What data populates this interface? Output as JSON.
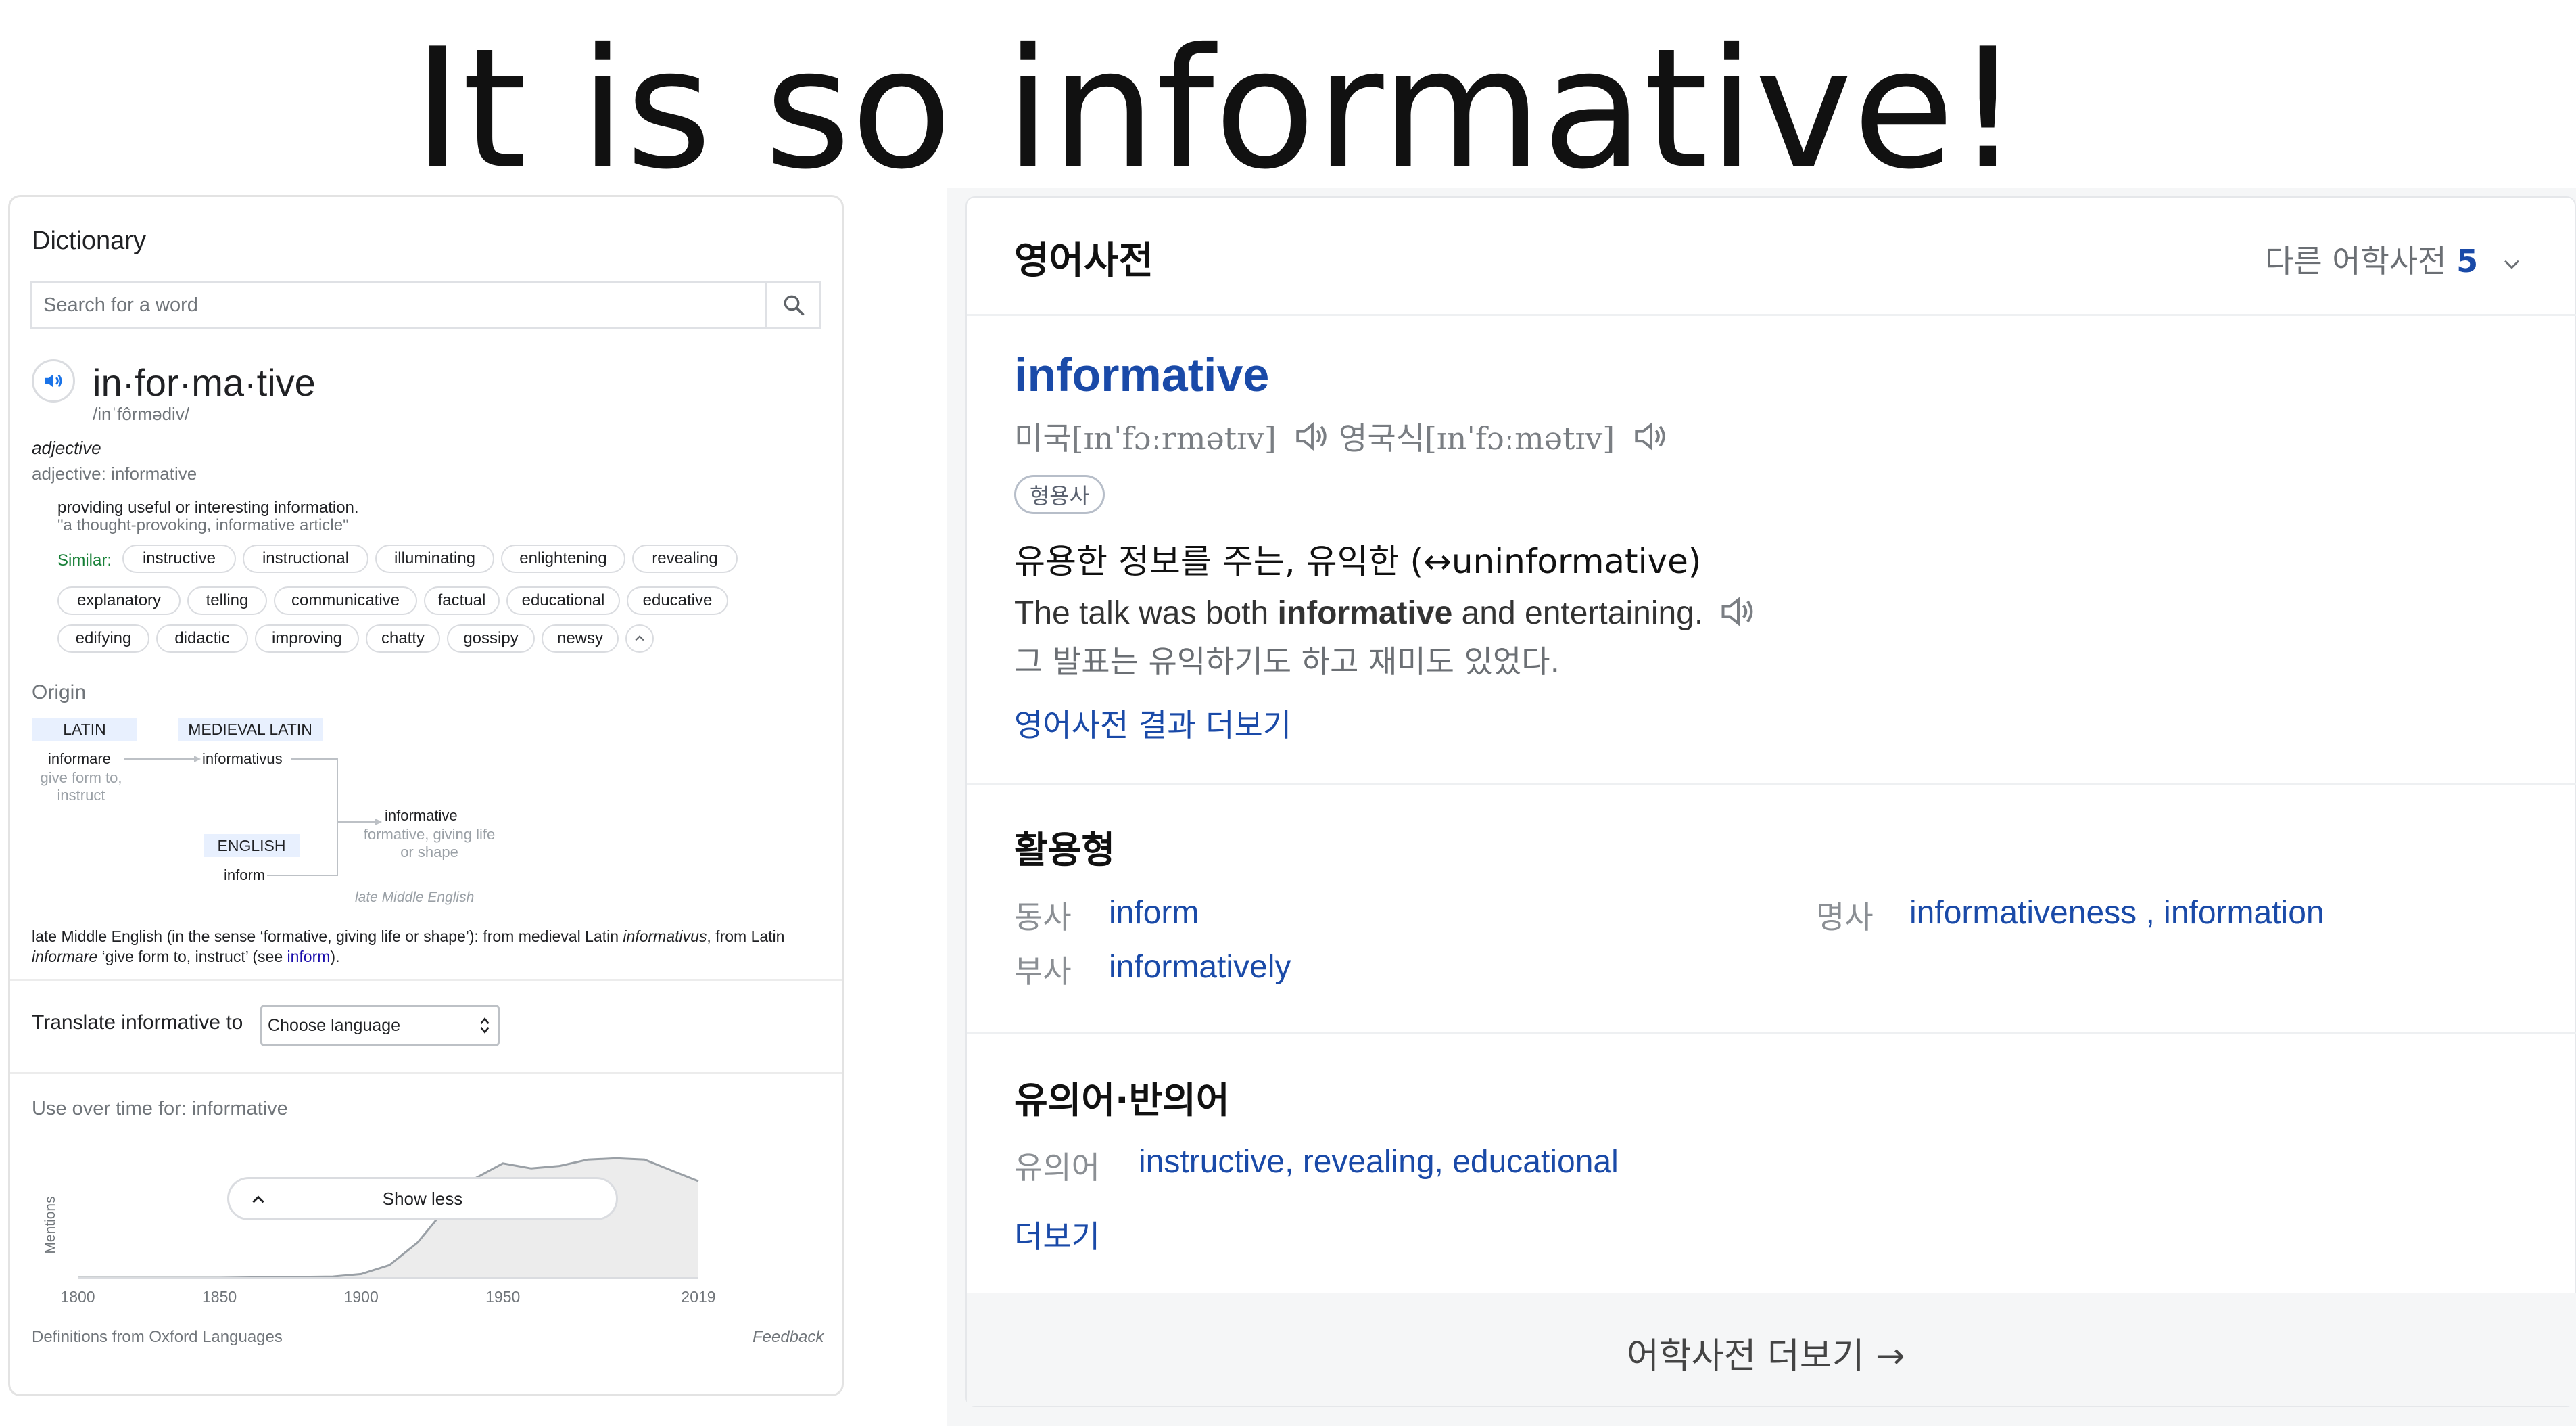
{
  "slide": {
    "title": "It is so informative!"
  },
  "google_dictionary": {
    "heading": "Dictionary",
    "search_placeholder": "Search for a word",
    "headword": "in·for·ma·tive",
    "phonetic": "/inˈfôrmədiv/",
    "part_of_speech": "adjective",
    "pos_line": "adjective: informative",
    "definition": "providing useful or interesting information.",
    "example": "\"a thought-provoking, informative article\"",
    "similar_label": "Similar:",
    "similar_words": [
      "instructive",
      "instructional",
      "illuminating",
      "enlightening",
      "revealing",
      "explanatory",
      "telling",
      "communicative",
      "factual",
      "educational",
      "educative",
      "edifying",
      "didactic",
      "improving",
      "chatty",
      "gossipy",
      "newsy"
    ],
    "origin_heading": "Origin",
    "etymology": {
      "latin_tag": "LATIN",
      "medieval_latin_tag": "MEDIEVAL LATIN",
      "english_tag": "ENGLISH",
      "informare": "informare",
      "informare_gloss": "give form to, instruct",
      "informativus": "informativus",
      "inform": "inform",
      "informative": "informative",
      "informative_gloss": "formative, giving life or shape",
      "era": "late Middle English"
    },
    "etymology_text": {
      "p1": "late Middle English (in the sense ‘formative, giving life or shape’): from medieval Latin ",
      "w1": "informativus",
      "p2": ", from Latin ",
      "w2": "informare",
      "p3": " ‘give form to, instruct’ (see ",
      "link": "inform",
      "p4": ")."
    },
    "translate_label": "Translate informative to",
    "language_select": "Choose language",
    "usage_label": "Use over time for: informative",
    "oxford_credit": "Definitions from Oxford Languages",
    "feedback": "Feedback",
    "show_less": "Show less"
  },
  "chart_data": {
    "type": "area",
    "title": "Use over time for: informative",
    "ylabel": "Mentions",
    "x_ticks": [
      "1800",
      "1850",
      "1900",
      "1950",
      "2019"
    ],
    "x": [
      1800,
      1850,
      1890,
      1900,
      1910,
      1920,
      1930,
      1940,
      1950,
      1960,
      1970,
      1980,
      1990,
      2000,
      2010,
      2019
    ],
    "y": [
      0.0,
      0.0,
      0.01,
      0.03,
      0.1,
      0.28,
      0.55,
      0.78,
      0.9,
      0.86,
      0.88,
      0.93,
      0.94,
      0.93,
      0.84,
      0.76
    ],
    "ylim": [
      0,
      1
    ],
    "xlim": [
      1800,
      2019
    ]
  },
  "naver_dictionary": {
    "title": "영어사전",
    "other_dicts_label": "다른 어학사전",
    "other_dicts_count": "5",
    "headword": "informative",
    "pron_us": "미국[ɪnˈfɔːrmətɪv]",
    "pron_uk": "영국식[ɪnˈfɔːmətɪv]",
    "pos_badge": "형용사",
    "meaning": "유용한 정보를 주는, 유익한 (↔uninformative)",
    "example_before": "The talk was both ",
    "example_bold": "informative",
    "example_after": " and entertaining.",
    "example_ko": "그 발표는 유익하기도 하고 재미도 있었다.",
    "more_results": "영어사전 결과 더보기",
    "conjugation_title": "활용형",
    "verb_label": "동사",
    "verb_value": "inform",
    "noun_label": "명사",
    "noun_value_1": "informativeness",
    "noun_sep": " , ",
    "noun_value_2": "information",
    "adverb_label": "부사",
    "adverb_value": "informatively",
    "synonym_title": "유의어·반의어",
    "synonym_label": "유의어",
    "synonyms": [
      "instructive",
      "revealing",
      "educational"
    ],
    "synonym_more": "더보기",
    "language_dict_more": "어학사전 더보기 →"
  }
}
